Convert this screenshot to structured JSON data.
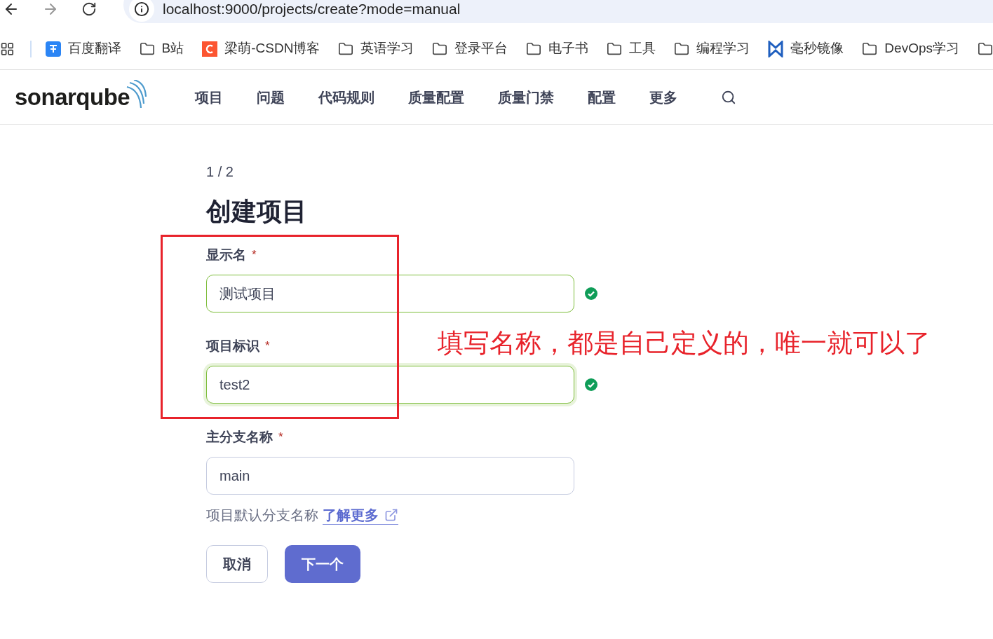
{
  "browser": {
    "url": "localhost:9000/projects/create?mode=manual"
  },
  "bookmarks": [
    {
      "kind": "translate",
      "label": "百度翻译"
    },
    {
      "kind": "folder",
      "label": "B站"
    },
    {
      "kind": "csdn",
      "label": "梁萌-CSDN博客"
    },
    {
      "kind": "folder",
      "label": "英语学习"
    },
    {
      "kind": "folder",
      "label": "登录平台"
    },
    {
      "kind": "folder",
      "label": "电子书"
    },
    {
      "kind": "folder",
      "label": "工具"
    },
    {
      "kind": "folder",
      "label": "编程学习"
    },
    {
      "kind": "mirror",
      "label": "毫秒镜像"
    },
    {
      "kind": "folder",
      "label": "DevOps学习"
    },
    {
      "kind": "folder"
    }
  ],
  "brand": {
    "name": "sonarqube"
  },
  "nav": [
    {
      "label": "项目"
    },
    {
      "label": "问题"
    },
    {
      "label": "代码规则"
    },
    {
      "label": "质量配置"
    },
    {
      "label": "质量门禁"
    },
    {
      "label": "配置"
    },
    {
      "label": "更多"
    }
  ],
  "step": "1 / 2",
  "title": "创建项目",
  "fields": [
    {
      "label": "显示名",
      "asterisk": "*",
      "value": "测试项目",
      "valid": true,
      "focused": false
    },
    {
      "label": "项目标识",
      "asterisk": "*",
      "value": "test2",
      "valid": true,
      "focused": true
    },
    {
      "label": "主分支名称",
      "asterisk": "*",
      "value": "main",
      "valid": false,
      "focused": false,
      "help": "项目默认分支名称",
      "link": "了解更多"
    }
  ],
  "buttons": [
    {
      "label": "取消",
      "kind": "secondary"
    },
    {
      "label": "下一个",
      "kind": "primary"
    }
  ],
  "annotation": {
    "text": "填写名称，都是自己定义的，唯一就可以了"
  }
}
